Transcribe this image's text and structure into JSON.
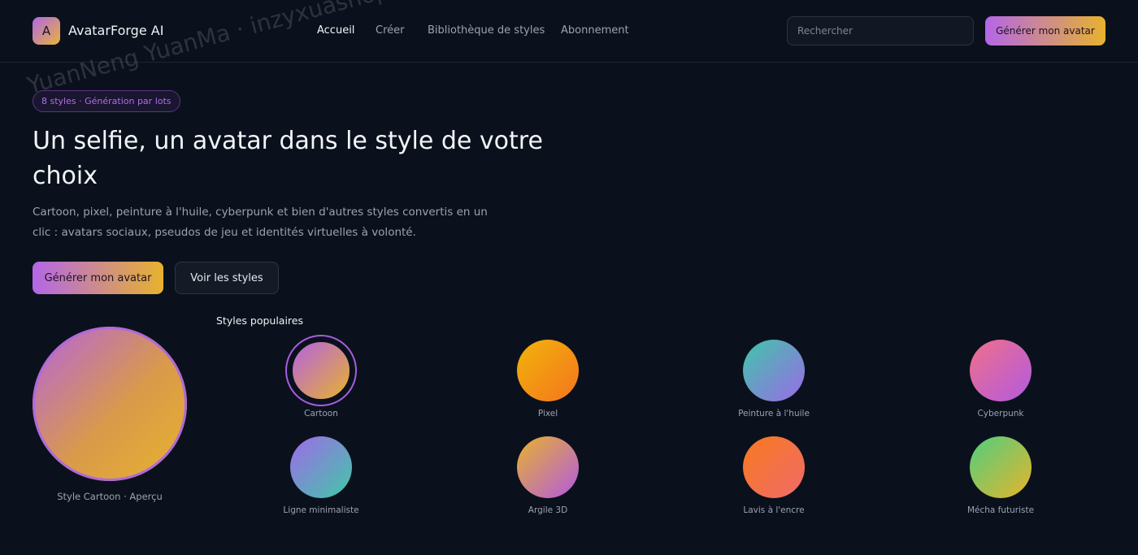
{
  "header": {
    "logo_letter": "A",
    "brand": "AvatarForge AI",
    "nav": [
      {
        "label": "Accueil",
        "active": true
      },
      {
        "label": "Créer",
        "active": false
      },
      {
        "label": "Bibliothèque de styles",
        "active": false
      },
      {
        "label": "Abonnement",
        "active": false
      }
    ],
    "search_placeholder": "Rechercher",
    "cta_label": "Générer mon avatar"
  },
  "hero": {
    "pill": "8 styles · Génération par lots",
    "title": "Un selfie, un avatar dans le style de votre choix",
    "subtitle": "Cartoon, pixel, peinture à l'huile, cyberpunk et bien d'autres styles convertis en un clic : avatars sociaux, pseudos de jeu et identités virtuelles à volonté.",
    "primary_cta": "Générer mon avatar",
    "secondary_cta": "Voir les styles"
  },
  "preview": {
    "label": "Style Cartoon · Aperçu"
  },
  "styles": {
    "title": "Styles populaires",
    "items": [
      {
        "label": "Cartoon",
        "selected": true
      },
      {
        "label": "Pixel",
        "selected": false
      },
      {
        "label": "Peinture à l'huile",
        "selected": false
      },
      {
        "label": "Cyberpunk",
        "selected": false
      },
      {
        "label": "Ligne minimaliste",
        "selected": false
      },
      {
        "label": "Argile 3D",
        "selected": false
      },
      {
        "label": "Lavis à l'encre",
        "selected": false
      },
      {
        "label": "Mécha futuriste",
        "selected": false
      }
    ]
  },
  "watermark": "YuanNeng YuanMa · inzyxuashop.com",
  "colors": {
    "background": "#0b111c",
    "accent_start": "#b466e8",
    "accent_end": "#e7b22e"
  }
}
